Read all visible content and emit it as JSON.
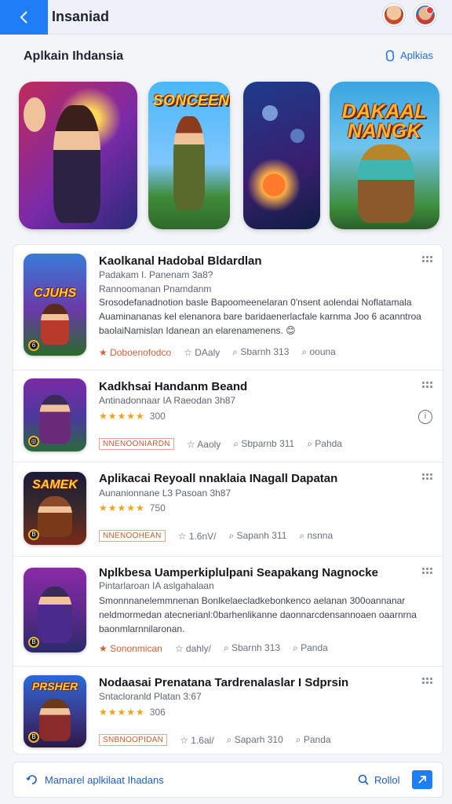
{
  "header": {
    "title": "Insaniad",
    "back_icon": "chevron-left-icon"
  },
  "section": {
    "title": "Aplkain Ihdansia",
    "action_label": "Aplkias"
  },
  "featured": [
    {
      "name": "featured-hero",
      "label": ""
    },
    {
      "name": "featured-sonceen",
      "label": "SONCEEN"
    },
    {
      "name": "featured-space",
      "label": ""
    },
    {
      "name": "featured-dakaal",
      "label": "DAKAAL NANGK"
    }
  ],
  "apps": [
    {
      "title": "Kaolkanal Hadobal Bldardlan",
      "subtitle": "Padakam I. Panenam 3a8?",
      "subtitle2": "Rannoomanan Pnamdanm",
      "desc": "Srosodefanadnotion basle Bapoomeenelaran 0'nsent aolendai Noflatamala Auaminananas kel elenanora bare baridaenerlacfale karnma Joo 6 acanntroa baolaiNamislan Idanean an elarenamenens. 😊",
      "thumb_label": "CJUHS",
      "tag": "Doboenofodco",
      "meta1": "DAaly",
      "meta2": "Sbarnh 313",
      "meta3": "oouna"
    },
    {
      "title": "Kadkhsai Handanm Beand",
      "subtitle": "Antinadonnaar IA Raeodan 3h87",
      "stars": "★★★★★",
      "rating_count": "300",
      "tag": "NNENOONIARDN",
      "meta1": "Aaoly",
      "meta2": "Sbparnb 311",
      "meta3": "Pahda"
    },
    {
      "title": "Aplikacai Reyoall nnaklaia INagall Dapatan",
      "subtitle": "Aunanionnane L3 Pasoan 3h87",
      "stars": "★★★★★",
      "rating_count": "750",
      "thumb_label": "SAMEK",
      "tag": "NNENOOHEAN",
      "meta1": "1.6nV/",
      "meta2": "Sapanh 311",
      "meta3": "nsnna"
    },
    {
      "title": "Nplkbesa Uamperkiplulpani Seapakang Nagnocke",
      "subtitle": "Pintarlaroan IA aslgahalaan",
      "desc": "Smonnnanelemmnenan Bonlkelaecladkebonkenco aelanan 300oannanar neldmormedan atecnerianl:0barhenlikanne daonnarcdensannoaen oaarnrna baonmlarnnilaronan.",
      "tag": "Sononmican",
      "meta1": "dahly/",
      "meta2": "Sbarnh 313",
      "meta3": "Panda"
    },
    {
      "title": "Nodaasai Prenatana Tardrenalaslar I Sdprsin",
      "subtitle": "Sntacloranld Platan 3:67",
      "stars": "★★★★★",
      "rating_count": "306",
      "thumb_label": "PRSHER",
      "tag": "SNBNOOPIDAN",
      "meta1": "1.6al/",
      "meta2": "Saparh 310",
      "meta3": "Panda"
    }
  ],
  "bottom": {
    "left_label": "Mamarel aplkilaat Ihadans",
    "right_label": "Rollol"
  },
  "colors": {
    "accent": "#1f7df6",
    "link": "#1f5fc2",
    "star": "#f0a21a",
    "tag": "#d0603a"
  }
}
